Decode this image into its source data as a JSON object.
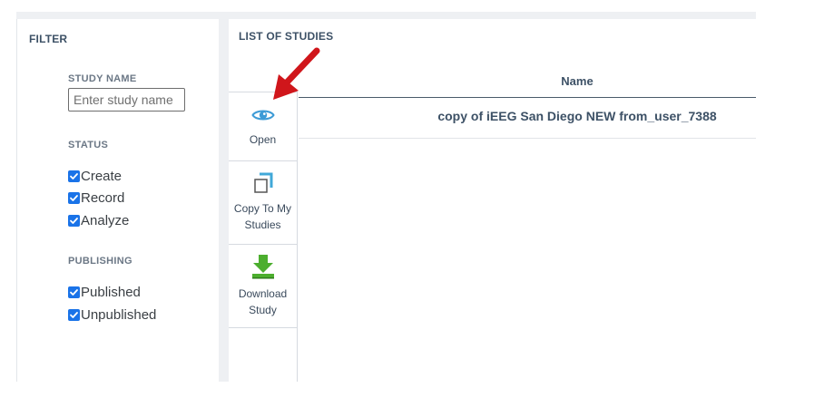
{
  "filter": {
    "title": "FILTER",
    "study_name": {
      "label": "STUDY NAME",
      "placeholder": "Enter study name",
      "value": ""
    },
    "status": {
      "label": "STATUS",
      "options": [
        {
          "label": "Create",
          "checked": true
        },
        {
          "label": "Record",
          "checked": true
        },
        {
          "label": "Analyze",
          "checked": true
        }
      ]
    },
    "publishing": {
      "label": "PUBLISHING",
      "options": [
        {
          "label": "Published",
          "checked": true
        },
        {
          "label": "Unpublished",
          "checked": true
        }
      ]
    }
  },
  "studies": {
    "title": "LIST OF STUDIES",
    "columns": [
      "Name"
    ],
    "rows": [
      {
        "name": "copy of iEEG San Diego NEW from_user_7388"
      }
    ],
    "actions": [
      {
        "label": "Open",
        "icon": "eye-icon"
      },
      {
        "label": "Copy To My Studies",
        "icon": "copy-icon"
      },
      {
        "label": "Download Study",
        "icon": "download-icon"
      }
    ]
  },
  "annotation": {
    "arrow_color": "#d0161b",
    "icon": "red-arrow-icon"
  },
  "colors": {
    "checkbox": "#1a73e8",
    "eye": "#3d9bd6",
    "copy_accent": "#41a8d8",
    "download": "#4cae2e"
  }
}
